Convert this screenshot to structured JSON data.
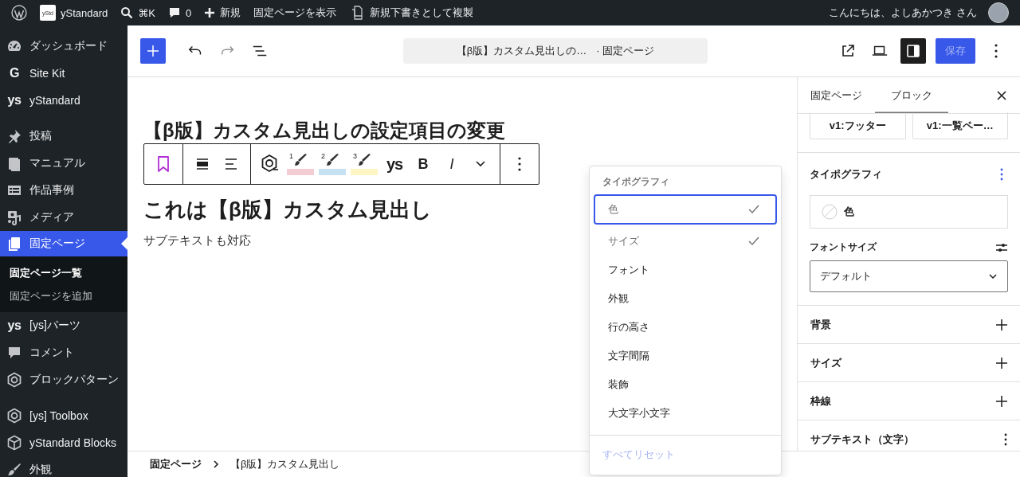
{
  "admin_bar": {
    "site_logo_text": "yStd",
    "site_name": "yStandard",
    "search_shortcut": "⌘K",
    "comments_count": "0",
    "new_label": "新規",
    "view_page": "固定ページを表示",
    "duplicate": "新規下書きとして複製",
    "greeting": "こんにちは、よしあかつき さん"
  },
  "sidebar": {
    "groups": [
      [
        {
          "kind": "dashboard",
          "label": "ダッシュボード",
          "selected": false
        },
        {
          "kind": "text-logo",
          "logo_text": "G",
          "label": "Site Kit",
          "selected": false
        },
        {
          "kind": "text-logo",
          "logo_text": "ys",
          "label": "yStandard",
          "selected": false
        }
      ],
      [
        {
          "kind": "pin",
          "label": "投稿",
          "selected": false
        },
        {
          "kind": "book",
          "label": "マニュアル",
          "selected": false
        },
        {
          "kind": "table",
          "label": "作品事例",
          "selected": false
        },
        {
          "kind": "media",
          "label": "メディア",
          "selected": false
        },
        {
          "kind": "page",
          "label": "固定ページ",
          "selected": true,
          "children": [
            {
              "label": "固定ページ一覧",
              "selected": true
            },
            {
              "label": "固定ページを追加",
              "selected": false
            }
          ]
        },
        {
          "kind": "text-logo",
          "logo_text": "ys",
          "label": "[ys]パーツ",
          "selected": false
        },
        {
          "kind": "comment",
          "label": "コメント",
          "selected": false
        },
        {
          "kind": "hex",
          "label": "ブロックパターン",
          "selected": false
        }
      ],
      [
        {
          "kind": "hex",
          "label": "[ys] Toolbox",
          "selected": false
        },
        {
          "kind": "cube",
          "label": "yStandard Blocks",
          "selected": false
        },
        {
          "kind": "brush",
          "label": "外観",
          "selected": false
        }
      ]
    ]
  },
  "editor_header": {
    "tools": [
      {
        "kind": "undo",
        "disabled": false
      },
      {
        "kind": "redo",
        "disabled": true
      },
      {
        "kind": "list",
        "disabled": false
      }
    ],
    "document_title": "【β版】カスタム見出しの…",
    "document_type": "· 固定ページ",
    "sidebar_toggle_pressed": true,
    "save": {
      "label": "保存",
      "disabled": true
    }
  },
  "canvas": {
    "page_title": "【β版】カスタム見出しの設定項目の変更",
    "heading": "これは【β版】カスタム見出し",
    "subtext": "サブテキストも対応",
    "toolbar": {
      "highlighters": [
        {
          "label": "1",
          "color": "#f4ccd3"
        },
        {
          "label": "2",
          "color": "#c6e1f1"
        },
        {
          "label": "3",
          "color": "#fdf5c3"
        }
      ],
      "ys_label": "ys",
      "bold": "B",
      "italic": "I"
    }
  },
  "typography_menu": {
    "title": "タイポグラフィ",
    "items": [
      {
        "label": "色",
        "checked": true,
        "selected": true
      },
      {
        "label": "サイズ",
        "checked": true,
        "selected": false
      },
      {
        "label": "フォント",
        "checked": false,
        "selected": false
      },
      {
        "label": "外観",
        "checked": false,
        "selected": false
      },
      {
        "label": "行の高さ",
        "checked": false,
        "selected": false
      },
      {
        "label": "文字間隔",
        "checked": false,
        "selected": false
      },
      {
        "label": "装飾",
        "checked": false,
        "selected": false
      },
      {
        "label": "大文字小文字",
        "checked": false,
        "selected": false
      }
    ],
    "reset": {
      "label": "すべてリセット",
      "disabled": true
    }
  },
  "settings": {
    "tabs": [
      {
        "label": "固定ページ",
        "selected": false
      },
      {
        "label": "ブロック",
        "selected": true
      }
    ],
    "style_buttons": [
      "v1:フッター",
      "v1:一覧ペー…"
    ],
    "typography": {
      "title": "タイポグラフィ",
      "color_label": "色",
      "font_size_label": "フォントサイズ",
      "font_size_value": "デフォルト"
    },
    "panels": [
      {
        "title": "背景",
        "kind": "add"
      },
      {
        "title": "サイズ",
        "kind": "add"
      },
      {
        "title": "枠線",
        "kind": "add"
      },
      {
        "title": "サブテキスト（文字）",
        "kind": "menu"
      }
    ]
  },
  "breadcrumb": [
    "固定ページ",
    "【β版】カスタム見出し"
  ]
}
